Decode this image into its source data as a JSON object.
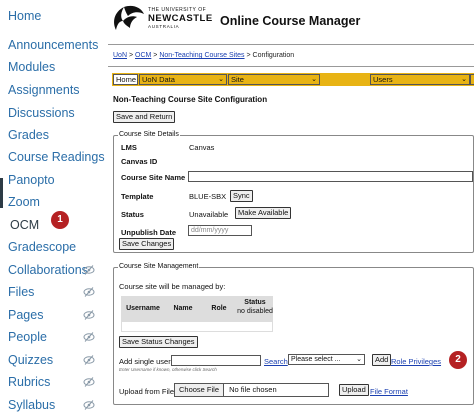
{
  "nav": {
    "items": [
      {
        "label": "Home",
        "hidden": false
      },
      {
        "label": "Announcements",
        "hidden": false
      },
      {
        "label": "Modules",
        "hidden": false
      },
      {
        "label": "Assignments",
        "hidden": false
      },
      {
        "label": "Discussions",
        "hidden": false
      },
      {
        "label": "Grades",
        "hidden": false
      },
      {
        "label": "Course Readings",
        "hidden": false
      },
      {
        "label": "Panopto",
        "hidden": false
      },
      {
        "label": "Zoom",
        "hidden": false
      },
      {
        "label": "OCM",
        "hidden": false,
        "active": true
      },
      {
        "label": "Gradescope",
        "hidden": false
      },
      {
        "label": "Collaborations",
        "hidden": true
      },
      {
        "label": "Files",
        "hidden": true
      },
      {
        "label": "Pages",
        "hidden": true
      },
      {
        "label": "People",
        "hidden": true
      },
      {
        "label": "Quizzes",
        "hidden": true
      },
      {
        "label": "Rubrics",
        "hidden": true
      },
      {
        "label": "Syllabus",
        "hidden": true
      }
    ],
    "hidden_icon": "eye-slash-icon",
    "badge_1": "1",
    "accent": "#2b6ea8"
  },
  "header": {
    "uni_small": "THE UNIVERSITY OF",
    "uni_big": "NEWCASTLE",
    "uni_country": "AUSTRALIA",
    "app_title": "Online Course Manager"
  },
  "breadcrumb": {
    "uon": "UoN",
    "sep1": " > ",
    "ocm": "OCM",
    "sep2": " > ",
    "non_teaching": "Non-Teaching Course Sites",
    "sep3": " > ",
    "current": "Configuration"
  },
  "menubar": {
    "home": "Home",
    "uon_data": "UoN Data",
    "site": "Site",
    "users": "Users",
    "caret": "⌄",
    "color": "#e8b314"
  },
  "page": {
    "heading": "Non-Teaching Course Site Configuration",
    "save_return": "Save and Return"
  },
  "details": {
    "legend": "Course Site Details",
    "lms_label": "LMS",
    "lms_value": "Canvas",
    "canvas_id_label": "Canvas ID",
    "canvas_id_value": "",
    "name_label": "Course Site Name",
    "name_value": "",
    "template_label": "Template",
    "template_value": "BLUE-SBX",
    "sync_button": "Sync",
    "status_label": "Status",
    "status_value": "Unavailable",
    "make_available": "Make Available",
    "unpublish_label": "Unpublish Date",
    "unpublish_placeholder": "dd/mm/yyyy",
    "save_changes": "Save Changes"
  },
  "management": {
    "legend": "Course Site Management",
    "managed_by": "Course site will be managed by:",
    "columns": [
      "Username",
      "Name",
      "Role",
      "Status",
      "no disabled"
    ],
    "save_status": "Save Status Changes",
    "add_user_label": "Add single user",
    "add_user_hint": "Enter Username if known, otherwise click Search",
    "search_link": "Search",
    "select_value": "Please select ...",
    "add_button": "Add",
    "role_privileges": "Role Privileges",
    "badge_2": "2",
    "upload_label": "Upload from File",
    "choose_file": "Choose File",
    "no_file": "No file chosen",
    "upload_button": "Upload",
    "file_format": "File Format"
  }
}
